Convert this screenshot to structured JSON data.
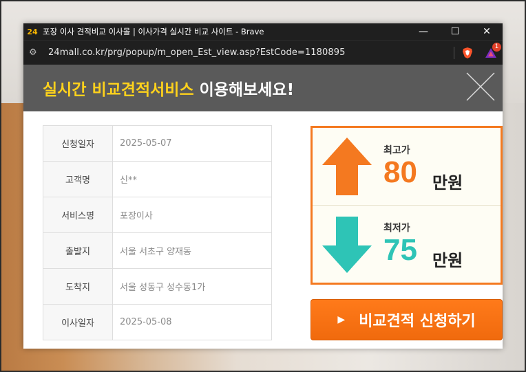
{
  "window": {
    "title": "포장 이사 견적비교 이사몰 | 이사가격 실시간 비교 사이트 - Brave",
    "url": "24mall.co.kr/prg/popup/m_open_Est_view.asp?EstCode=1180895",
    "rewards_badge": "1",
    "app_icon": "24"
  },
  "banner": {
    "highlight": "실시간 비교견적서비스",
    "rest": "이용해보세요!"
  },
  "info_rows": [
    {
      "label": "신청일자",
      "value": "2025-05-07"
    },
    {
      "label": "고객명",
      "value": "신**"
    },
    {
      "label": "서비스명",
      "value": "포장이사"
    },
    {
      "label": "출발지",
      "value": "서울 서초구 양재동"
    },
    {
      "label": "도착지",
      "value": "서울 성동구 성수동1가"
    },
    {
      "label": "이사일자",
      "value": "2025-05-08"
    }
  ],
  "price": {
    "high_label": "최고가",
    "high_value": "80",
    "low_label": "최저가",
    "low_value": "75",
    "unit": "만원",
    "accent_color": "#f47920",
    "low_color": "#2ec4b6"
  },
  "cta": {
    "label": "비교견적 신청하기"
  }
}
